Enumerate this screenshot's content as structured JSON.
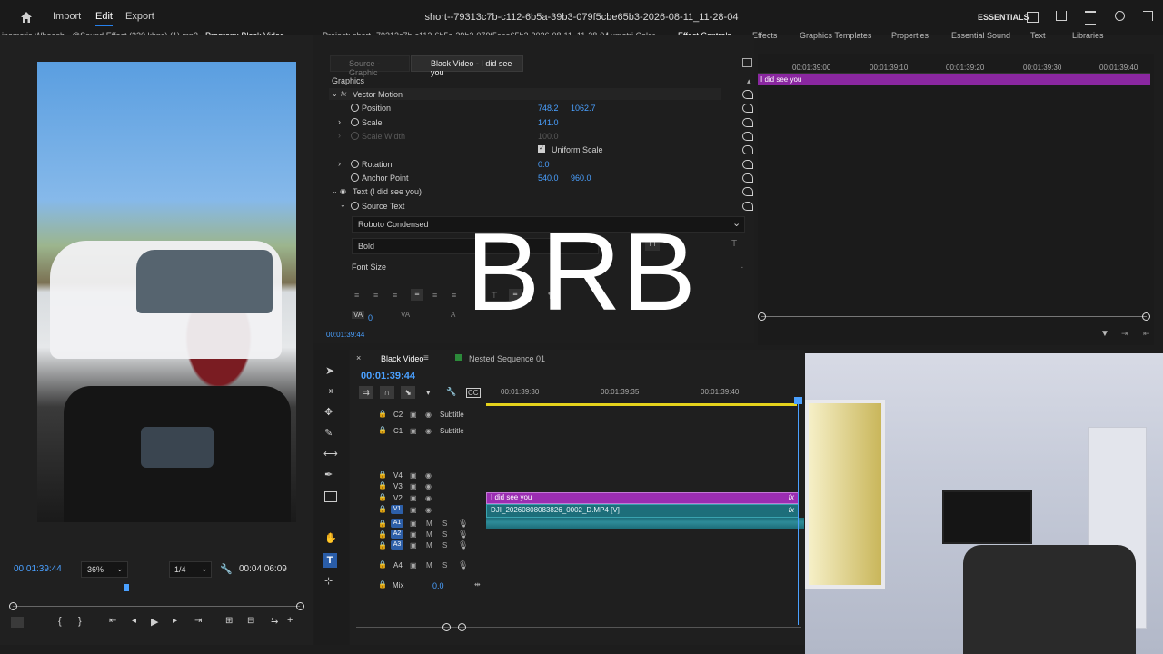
{
  "topbar": {
    "home_icon": "home-icon",
    "nav": [
      "Import",
      "Edit",
      "Export"
    ],
    "title": "short--79313c7b-c112-6b5a-39b3-079f5cbe65b3-2026-08-11_11-28-04",
    "workspace": "ESSENTIALS"
  },
  "program": {
    "tab_audio": "inematic Whoosh - @Sound Effect (320 kbps) (1).mp3",
    "tab_program": "Program: Black Video",
    "timecode": "00:01:39:44",
    "zoom": "36%",
    "resolution": "1/4",
    "duration": "00:04:06:09"
  },
  "panel_tabs": {
    "project": "Project: short--79313c7b-c112-6b5a-39b3-079f5cbe65b3-2026-08-11_11-28-04",
    "lumetri": "Lumetri Color",
    "effect_controls": "Effect Controls",
    "effects": "Effects",
    "graphics_templates": "Graphics Templates",
    "properties": "Properties",
    "essential_sound": "Essential Sound",
    "text": "Text",
    "libraries": "Libraries"
  },
  "effect_controls": {
    "source_tab": "Source - Graphic",
    "clip_tab": "Black Video - I did see you",
    "section": "Graphics",
    "vector_motion": "Vector Motion",
    "position_label": "Position",
    "position_x": "748.2",
    "position_y": "1062.7",
    "scale_label": "Scale",
    "scale_value": "141.0",
    "scale_width_label": "Scale Width",
    "scale_width_value": "100.0",
    "uniform_scale": "Uniform Scale",
    "rotation_label": "Rotation",
    "rotation_value": "0.0",
    "anchor_label": "Anchor Point",
    "anchor_x": "540.0",
    "anchor_y": "960.0",
    "text_layer": "Text (I did see you)",
    "source_text": "Source Text",
    "font": "Roboto Condensed",
    "font_style": "Bold",
    "font_size_label": "Font Size",
    "va_value": "0",
    "timecode": "00:01:39:44"
  },
  "ec_timeline": {
    "ticks": [
      "00:01:39:00",
      "00:01:39:10",
      "00:01:39:20",
      "00:01:39:30",
      "00:01:39:40"
    ],
    "clip_label": "I did see you"
  },
  "timeline": {
    "tab_active": "Black Video",
    "tab_nested": "Nested Sequence 01",
    "timecode": "00:01:39:44",
    "ruler": [
      "00:01:39:30",
      "00:01:39:35",
      "00:01:39:40"
    ],
    "caption_tracks": [
      {
        "id": "C2",
        "label": "Subtitle"
      },
      {
        "id": "C1",
        "label": "Subtitle"
      }
    ],
    "video_tracks": [
      "V4",
      "V3",
      "V2",
      "V1"
    ],
    "audio_tracks": [
      "A1",
      "A2",
      "A3",
      "A4"
    ],
    "mix_label": "Mix",
    "mix_value": "0.0",
    "clip_v2": "I did see you",
    "clip_v1": "DJI_20260808083826_0002_D.MP4 [V]",
    "fx": "fx"
  },
  "overlay": {
    "brb": "BRB"
  }
}
